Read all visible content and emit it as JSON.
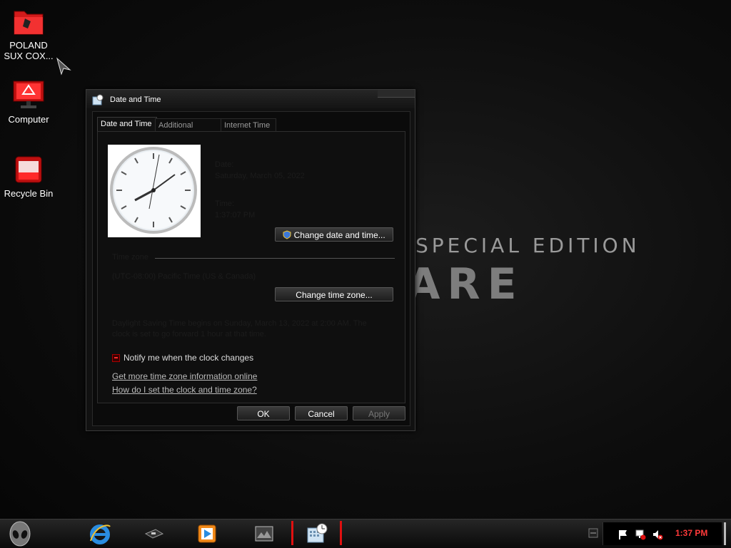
{
  "desktop": {
    "icons": [
      {
        "label_line1": "POLAND",
        "label_line2": "SUX COX..."
      },
      {
        "label": "Computer"
      },
      {
        "label": "Recycle Bin"
      }
    ],
    "brand": {
      "special_edition": "SPECIAL EDITION",
      "logo": "ARE"
    }
  },
  "dialog": {
    "title": "Date and Time",
    "tabs": [
      "Date and Time",
      "Additional Clocks",
      "Internet Time"
    ],
    "date_label": "Date:",
    "date_value": "Saturday, March 05, 2022",
    "time_label": "Time:",
    "time_value": "1:37:07 PM",
    "change_datetime_button": "Change date and time...",
    "timezone_group_title": "Time zone",
    "timezone_value": "(UTC-08:00) Pacific Time (US & Canada)",
    "change_timezone_button": "Change time zone...",
    "dst_line1": "Daylight Saving Time begins on Sunday, March 13, 2022 at 2:00 AM. The",
    "dst_line2": "clock is set to go forward 1 hour at that time.",
    "notify_checkbox": "Notify me when the clock changes",
    "notify_checked": true,
    "link_more_info": "Get more time zone information online",
    "link_how_to": "How do I set the clock and time zone?",
    "ok_button": "OK",
    "cancel_button": "Cancel",
    "apply_button": "Apply"
  },
  "taskbar": {
    "items": [
      "alien-start-icon",
      "internet-explorer-icon",
      "device-icon",
      "media-player-icon",
      "photo-viewer-icon",
      "date-time-icon"
    ],
    "clock": "1:37 PM",
    "accent": "#e01010"
  }
}
